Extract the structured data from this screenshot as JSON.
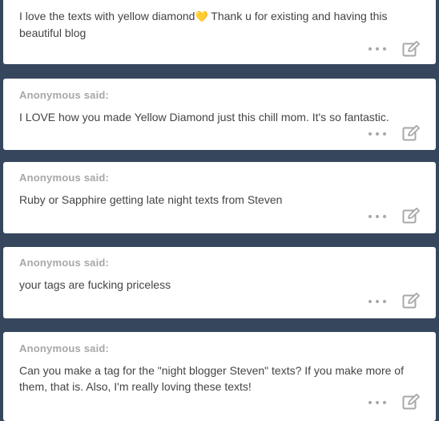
{
  "posts": [
    {
      "asker": "",
      "text_before": "I love the texts with yellow diamond",
      "heart": "💛",
      "text_after": " Thank u for existing and having this beautiful blog"
    },
    {
      "asker": "Anonymous said:",
      "text": "I LOVE how you made Yellow Diamond just this chill mom. It's so fantastic."
    },
    {
      "asker": "Anonymous said:",
      "text": "Ruby or Sapphire getting late night texts from Steven"
    },
    {
      "asker": "Anonymous said:",
      "text": "your tags are fucking priceless"
    },
    {
      "asker": "Anonymous said:",
      "text": "Can you make a tag for the \"night blogger Steven\" texts? If you make more of them, that is. Also, I'm really loving these texts!"
    }
  ],
  "icons": {
    "more": "more-options-icon",
    "edit": "edit-icon"
  },
  "colors": {
    "background": "#36465d",
    "card": "#ffffff",
    "asker_text": "#a7a7a7",
    "body_text": "#444444",
    "icon": "#a8a8a8"
  }
}
